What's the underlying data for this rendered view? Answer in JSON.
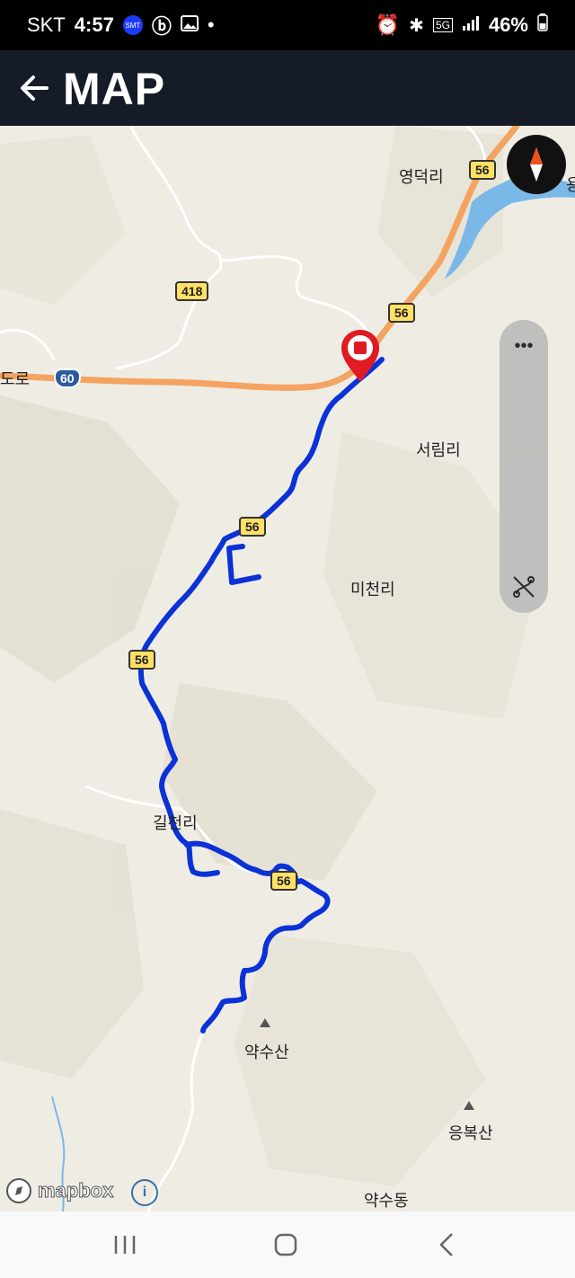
{
  "status_bar": {
    "carrier": "SKT",
    "time": "4:57",
    "app_badge": "SMT",
    "dot": "•",
    "network": "5G",
    "battery": "46%"
  },
  "header": {
    "title": "MAP"
  },
  "map": {
    "places": [
      {
        "key": "p1",
        "name": "영덕리"
      },
      {
        "key": "p2",
        "name": "서림리"
      },
      {
        "key": "p3",
        "name": "미천리"
      },
      {
        "key": "p4",
        "name": "길천리"
      },
      {
        "key": "p5",
        "name": "약수산"
      },
      {
        "key": "p6",
        "name": "응복산"
      },
      {
        "key": "p7",
        "name": "약수동"
      },
      {
        "key": "p8",
        "name": "도로"
      },
      {
        "key": "p9",
        "name": "용"
      }
    ],
    "shields": {
      "s56a": "56",
      "s56b": "56",
      "s56c": "56",
      "s56d": "56",
      "s56e": "56",
      "s418": "418",
      "s60": "60"
    },
    "attribution": "mapbox"
  },
  "colors": {
    "route": "#0a32d6",
    "marker": "#e01b24",
    "highway": "#f4a460",
    "header_bg": "#161c27",
    "water": "#7ab8e8"
  }
}
